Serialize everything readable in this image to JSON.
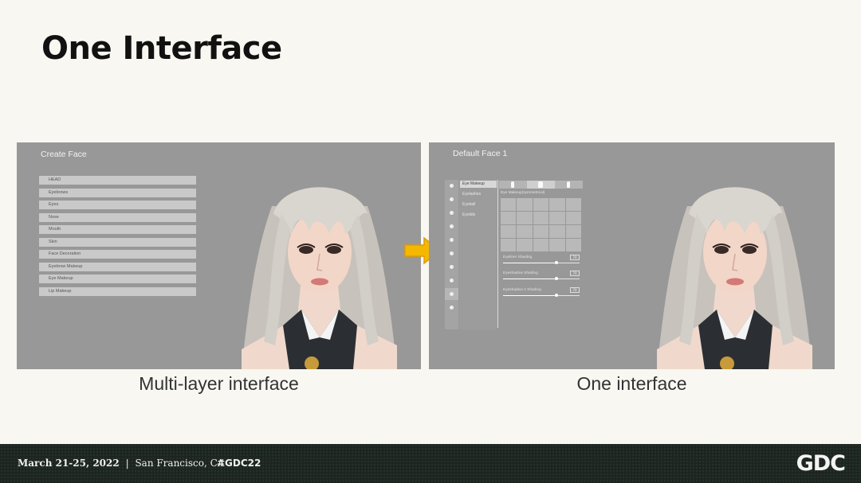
{
  "slide": {
    "title": "One Interface"
  },
  "left_panel": {
    "title": "Create Face",
    "menu_items": [
      "HEAD",
      "Eyebrows",
      "Eyes",
      "Nose",
      "Mouth",
      "Skin",
      "Face Decoration",
      "Eyebrow Makeup",
      "Eye Makeup",
      "Lip Makeup"
    ],
    "caption": "Multi-layer interface"
  },
  "right_panel": {
    "title": "Default Face 1",
    "sub_items": [
      "Eye Makeup",
      "Eyelashes",
      "Eyeball",
      "Eyelids"
    ],
    "section_label": "Eye Makeup(symmetrical)",
    "sliders": [
      {
        "label": "Eyeliner Shading",
        "value": "70",
        "level": 0.7
      },
      {
        "label": "Eyeshadow Shading",
        "value": "70",
        "level": 0.7
      },
      {
        "label": "Eyeshadow 2 Shading",
        "value": "70",
        "level": 0.7
      }
    ],
    "caption": "One interface"
  },
  "footer": {
    "dates": "March 21-25, 2022",
    "separator": "|",
    "location": "San Francisco, CA",
    "hashtag": "#GDC22",
    "logo": "GDC"
  },
  "colors": {
    "background": "#f8f7f1",
    "panel": "#989898",
    "arrow": "#f5b800",
    "footer": "#1d2520"
  }
}
